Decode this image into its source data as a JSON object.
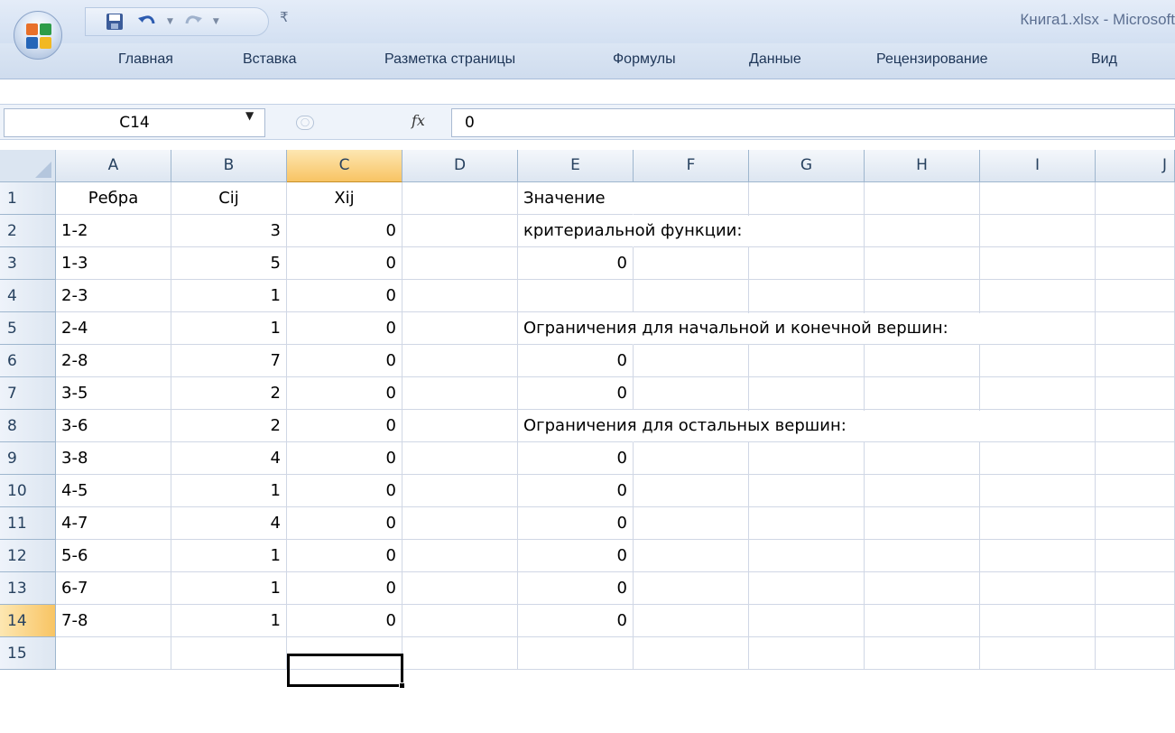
{
  "window": {
    "title": "Книга1.xlsx - Microsoft"
  },
  "qat": {
    "save": "save-icon",
    "undo": "undo-icon",
    "redo": "redo-icon"
  },
  "ribbon": {
    "tabs": [
      "Главная",
      "Вставка",
      "Разметка страницы",
      "Формулы",
      "Данные",
      "Рецензирование",
      "Вид"
    ]
  },
  "formula_bar": {
    "name_box": "C14",
    "fx_label": "fx",
    "value": "0"
  },
  "columns": [
    "A",
    "B",
    "C",
    "D",
    "E",
    "F",
    "G",
    "H",
    "I",
    "J"
  ],
  "selected": {
    "column": "C",
    "row": "14"
  },
  "rows": [
    {
      "n": "1",
      "a": "Ребра",
      "b": "Cij",
      "c": "Xij",
      "e": "Значение"
    },
    {
      "n": "2",
      "a": "1-2",
      "b": "3",
      "c": "0",
      "e": "критериальной функции:"
    },
    {
      "n": "3",
      "a": "1-3",
      "b": "5",
      "c": "0",
      "e": "0"
    },
    {
      "n": "4",
      "a": "2-3",
      "b": "1",
      "c": "0",
      "e": ""
    },
    {
      "n": "5",
      "a": "2-4",
      "b": "1",
      "c": "0",
      "e": "Ограничения для начальной и конечной вершин:"
    },
    {
      "n": "6",
      "a": "2-8",
      "b": "7",
      "c": "0",
      "e": "0"
    },
    {
      "n": "7",
      "a": "3-5",
      "b": "2",
      "c": "0",
      "e": "0"
    },
    {
      "n": "8",
      "a": "3-6",
      "b": "2",
      "c": "0",
      "e": "Ограничения для остальных вершин:"
    },
    {
      "n": "9",
      "a": "3-8",
      "b": "4",
      "c": "0",
      "e": "0"
    },
    {
      "n": "10",
      "a": "4-5",
      "b": "1",
      "c": "0",
      "e": "0"
    },
    {
      "n": "11",
      "a": "4-7",
      "b": "4",
      "c": "0",
      "e": "0"
    },
    {
      "n": "12",
      "a": "5-6",
      "b": "1",
      "c": "0",
      "e": "0"
    },
    {
      "n": "13",
      "a": "6-7",
      "b": "1",
      "c": "0",
      "e": "0"
    },
    {
      "n": "14",
      "a": "7-8",
      "b": "1",
      "c": "0",
      "e": "0"
    },
    {
      "n": "15",
      "a": "",
      "b": "",
      "c": "",
      "e": ""
    }
  ]
}
